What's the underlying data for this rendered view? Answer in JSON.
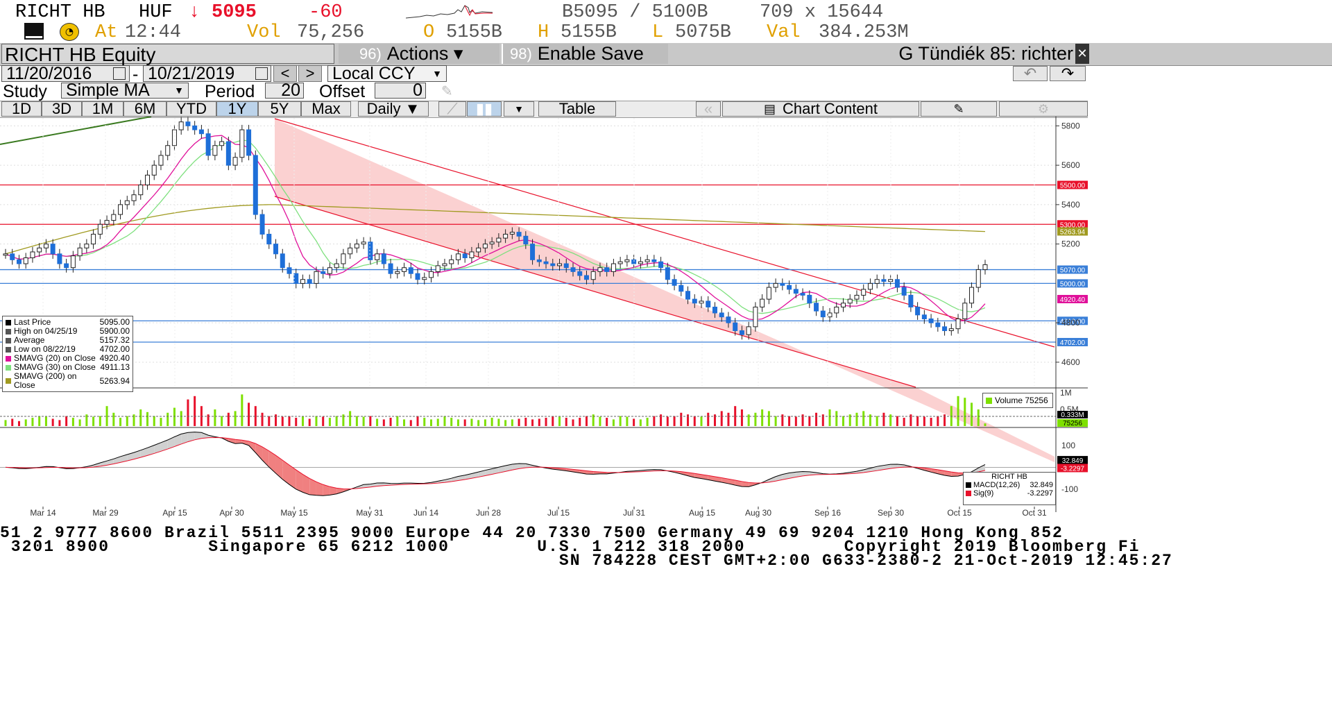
{
  "header": {
    "ticker": "RICHT HB",
    "currency": "HUF",
    "arrow": "↓",
    "last": "5095",
    "change": "-60",
    "bid_ask": "B5095 / 5100B",
    "size": "709 x 15644",
    "at_label": "At",
    "time": "12:44",
    "vol_label": "Vol",
    "vol": "75,256",
    "o_label": "O",
    "open": "5155B",
    "h_label": "H",
    "high": "5155B",
    "l_label": "L",
    "low": "5075B",
    "val_label": "Val",
    "val": "384.253M"
  },
  "titlebar": {
    "security": "RICHT HB Equity",
    "actions_num": "96)",
    "actions": "Actions ▾",
    "save_num": "98)",
    "save": "Enable Save",
    "name": "G Tündiék 85: richter"
  },
  "controls": {
    "date_from": "11/20/2016",
    "dash": "-",
    "date_to": "10/21/2019",
    "prev": "<",
    "next": ">",
    "ccy": "Local CCY",
    "study_label": "Study",
    "study": "Simple MA",
    "period_label": "Period",
    "period": "20",
    "offset_label": "Offset",
    "offset": "0"
  },
  "toolbar": {
    "ranges": [
      "1D",
      "3D",
      "1M",
      "6M",
      "YTD",
      "1Y",
      "5Y",
      "Max"
    ],
    "selected_range": "1Y",
    "freq": "Daily ▼",
    "table": "Table",
    "chart_content": "Chart Content"
  },
  "legend": {
    "rows": [
      {
        "label": "Last Price",
        "value": "5095.00",
        "color": "#000000"
      },
      {
        "label": "High on 04/25/19",
        "value": "5900.00",
        "color": "#555555"
      },
      {
        "label": "Average",
        "value": "5157.32",
        "color": "#555555"
      },
      {
        "label": "Low on 08/22/19",
        "value": "4702.00",
        "color": "#555555"
      },
      {
        "label": "SMAVG (20)  on Close",
        "value": "4920.40",
        "color": "#e0109a"
      },
      {
        "label": "SMAVG (30)  on Close",
        "value": "4911.13",
        "color": "#7ee07e"
      },
      {
        "label": "SMAVG (200)  on Close",
        "value": "5263.94",
        "color": "#a09a20"
      }
    ]
  },
  "volume_legend": "Volume 75256",
  "macd_legend": {
    "title": "RICHT HB",
    "macd_label": "MACD(12,26)",
    "macd_value": "32.849",
    "sig_label": "Sig(9)",
    "sig_value": "-3.2297"
  },
  "price_axis": {
    "ticks": [
      "5800",
      "5600",
      "5400",
      "5200",
      "4800",
      "4600"
    ],
    "tags": [
      {
        "text": "5500.00",
        "color": "#e8102a"
      },
      {
        "text": "5300.00",
        "color": "#e8102a"
      },
      {
        "text": "5263.94",
        "color": "#a09a20"
      },
      {
        "text": "5070.00",
        "color": "#3a7fd8"
      },
      {
        "text": "5000.00",
        "color": "#3a7fd8"
      },
      {
        "text": "4920.40",
        "color": "#e0109a"
      },
      {
        "text": "4810.00",
        "color": "#3a7fd8"
      },
      {
        "text": "4702.00",
        "color": "#3a7fd8"
      }
    ]
  },
  "volume_axis": {
    "ticks": [
      "1M",
      "0.5M"
    ],
    "tags": [
      "0.333M",
      "75256"
    ]
  },
  "macd_axis": {
    "ticks": [
      "100",
      "-100"
    ],
    "tags": [
      "32.849",
      "-3.2297"
    ]
  },
  "x_axis": {
    "labels": [
      "Mar 14",
      "Mar 29",
      "Apr 15",
      "Apr 30",
      "May 15",
      "May 31",
      "Jun 14",
      "Jun 28",
      "Jul 15",
      "Jul 31",
      "Aug 15",
      "Aug 30",
      "Sep 16",
      "Sep 30",
      "Oct 15",
      "Oct 31"
    ],
    "year": "2019"
  },
  "footer": {
    "line1": "51 2 9777 8600 Brazil 5511 2395 9000 Europe 44 20 7330 7500 Germany 49 69 9204 1210 Hong Kong 852",
    "line2": " 3201 8900         Singapore 65 6212 1000        U.S. 1 212 318 2000         Copyright 2019 Bloomberg Fi",
    "line3": "                                                   SN 784228 CEST GMT+2:00 G633-2380-2 21-Oct-2019 12:45:27"
  },
  "chart_data": {
    "type": "candlestick",
    "price_ylim": [
      4480,
      5840
    ],
    "horizontal_lines": [
      {
        "value": 5500,
        "color": "#e8102a"
      },
      {
        "value": 5300,
        "color": "#e8102a"
      },
      {
        "value": 5070,
        "color": "#3a7fd8"
      },
      {
        "value": 5000,
        "color": "#3a7fd8"
      },
      {
        "value": 4810,
        "color": "#3a7fd8"
      },
      {
        "value": 4702,
        "color": "#3a7fd8"
      }
    ],
    "close": [
      5150,
      5120,
      5100,
      5130,
      5160,
      5180,
      5200,
      5150,
      5100,
      5080,
      5140,
      5180,
      5200,
      5250,
      5300,
      5320,
      5350,
      5400,
      5420,
      5450,
      5500,
      5550,
      5600,
      5650,
      5700,
      5780,
      5820,
      5800,
      5780,
      5760,
      5650,
      5700,
      5720,
      5600,
      5640,
      5780,
      5650,
      5350,
      5250,
      5200,
      5150,
      5080,
      5050,
      5000,
      5020,
      5000,
      5060,
      5050,
      5080,
      5100,
      5150,
      5180,
      5200,
      5210,
      5120,
      5150,
      5100,
      5050,
      5060,
      5080,
      5050,
      5020,
      5030,
      5060,
      5090,
      5100,
      5120,
      5150,
      5130,
      5160,
      5180,
      5200,
      5210,
      5230,
      5250,
      5260,
      5240,
      5200,
      5120,
      5110,
      5100,
      5090,
      5100,
      5080,
      5060,
      5040,
      5020,
      5060,
      5080,
      5060,
      5100,
      5110,
      5120,
      5100,
      5110,
      5120,
      5110,
      5080,
      5020,
      4990,
      4960,
      4920,
      4900,
      4910,
      4880,
      4850,
      4830,
      4800,
      4760,
      4740,
      4780,
      4880,
      4920,
      4980,
      5000,
      4990,
      4970,
      4950,
      4940,
      4900,
      4860,
      4830,
      4850,
      4880,
      4900,
      4920,
      4940,
      4970,
      5000,
      5020,
      5010,
      5020,
      4980,
      4940,
      4880,
      4840,
      4820,
      4800,
      4780,
      4760,
      4770,
      4820,
      4900,
      4980,
      5070,
      5095
    ],
    "volume": [
      0.18,
      0.22,
      0.15,
      0.2,
      0.25,
      0.3,
      0.28,
      0.22,
      0.18,
      0.3,
      0.25,
      0.2,
      0.35,
      0.28,
      0.3,
      0.6,
      0.4,
      0.25,
      0.3,
      0.35,
      0.5,
      0.42,
      0.3,
      0.25,
      0.4,
      0.55,
      0.45,
      0.8,
      0.9,
      0.6,
      0.35,
      0.5,
      0.3,
      0.4,
      0.45,
      0.95,
      0.7,
      0.6,
      0.4,
      0.3,
      0.35,
      0.28,
      0.3,
      0.25,
      0.3,
      0.22,
      0.3,
      0.28,
      0.25,
      0.3,
      0.35,
      0.45,
      0.3,
      0.28,
      0.3,
      0.22,
      0.2,
      0.25,
      0.3,
      0.2,
      0.18,
      0.3,
      0.25,
      0.2,
      0.22,
      0.3,
      0.25,
      0.2,
      0.2,
      0.22,
      0.18,
      0.2,
      0.25,
      0.22,
      0.18,
      0.2,
      0.22,
      0.25,
      0.2,
      0.22,
      0.25,
      0.3,
      0.28,
      0.25,
      0.2,
      0.25,
      0.3,
      0.35,
      0.28,
      0.25,
      0.2,
      0.3,
      0.28,
      0.22,
      0.2,
      0.25,
      0.3,
      0.35,
      0.28,
      0.3,
      0.4,
      0.35,
      0.3,
      0.28,
      0.4,
      0.35,
      0.45,
      0.4,
      0.6,
      0.5,
      0.35,
      0.4,
      0.5,
      0.45,
      0.3,
      0.35,
      0.3,
      0.28,
      0.35,
      0.3,
      0.4,
      0.35,
      0.5,
      0.45,
      0.3,
      0.35,
      0.4,
      0.45,
      0.35,
      0.3,
      0.4,
      0.35,
      0.3,
      0.25,
      0.35,
      0.3,
      0.28,
      0.25,
      0.3,
      0.35,
      0.6,
      0.9,
      0.85,
      0.7,
      0.5,
      0.08
    ],
    "macd_ylim": [
      -180,
      170
    ]
  }
}
